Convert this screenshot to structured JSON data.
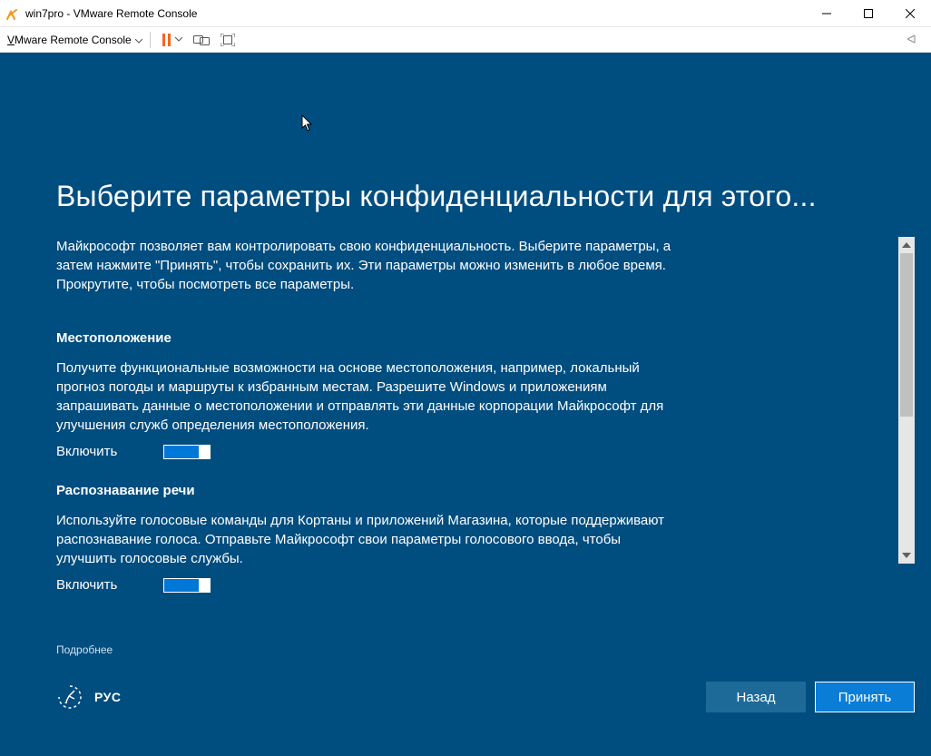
{
  "window": {
    "title": "win7pro - VMware Remote Console"
  },
  "toolbar": {
    "menu_label_prefix": "V",
    "menu_label_rest": "Mware Remote Console"
  },
  "oobe": {
    "title": "Выберите параметры конфиденциальности для этого...",
    "intro": "Майкрософт позволяет вам контролировать свою конфиденциальность. Выберите параметры, а затем нажмите \"Принять\", чтобы сохранить их. Эти параметры можно изменить в любое время. Прокрутите, чтобы посмотреть все параметры.",
    "settings": [
      {
        "title": "Местоположение",
        "body": "Получите функциональные возможности на основе местоположения, например, локальный прогноз погоды и маршруты к избранным местам. Разрешите Windows и приложениям запрашивать данные о местоположении и отправлять эти данные корпорации Майкрософт для улучшения служб определения местоположения.",
        "state_label": "Включить"
      },
      {
        "title": "Распознавание речи",
        "body": "Используйте голосовые команды для Кортаны и приложений Магазина, которые поддерживают распознавание голоса. Отправьте Майкрософт свои параметры голосового ввода, чтобы улучшить голосовые службы.",
        "state_label": "Включить"
      }
    ],
    "learn_more": "Подробнее",
    "lang_label": "РУС",
    "back": "Назад",
    "accept": "Принять"
  }
}
